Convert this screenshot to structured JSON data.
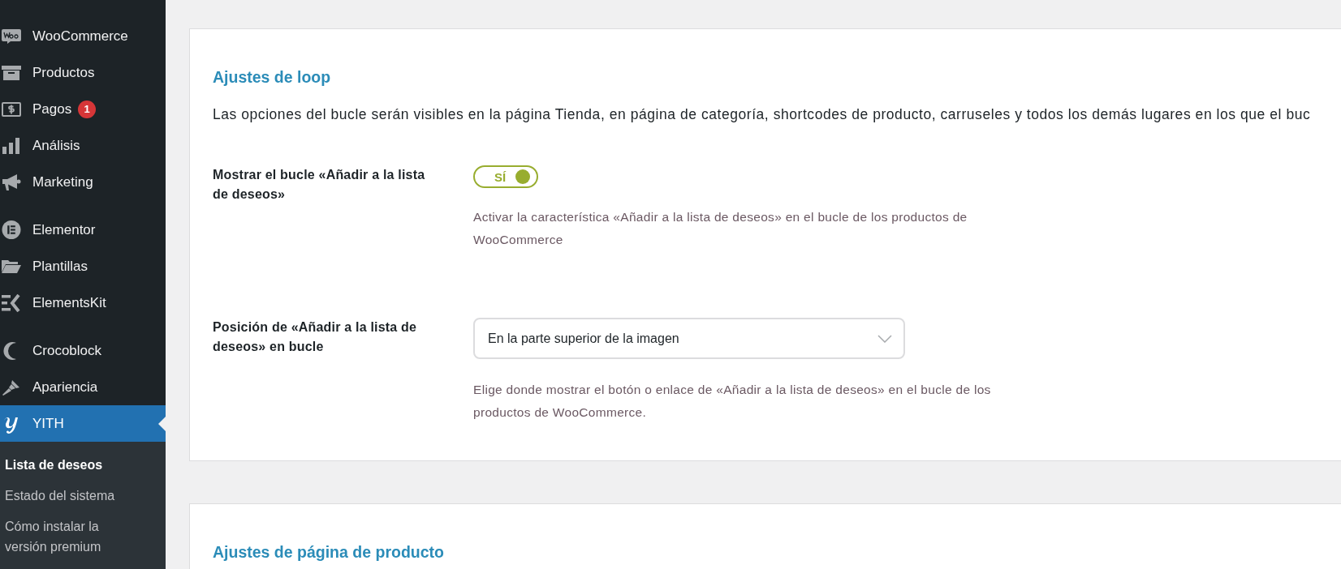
{
  "sidebar": {
    "groups": [
      {
        "items": [
          {
            "label": "WooCommerce",
            "selected": false
          },
          {
            "label": "Productos",
            "selected": false
          },
          {
            "label": "Pagos",
            "badge": "1",
            "selected": false
          },
          {
            "label": "Análisis",
            "selected": false
          },
          {
            "label": "Marketing",
            "selected": false
          }
        ]
      },
      {
        "items": [
          {
            "label": "Elementor",
            "selected": false
          },
          {
            "label": "Plantillas",
            "selected": false
          },
          {
            "label": "ElementsKit",
            "selected": false
          }
        ]
      },
      {
        "items": [
          {
            "label": "Crocoblock",
            "selected": false
          },
          {
            "label": "Apariencia",
            "selected": false
          },
          {
            "label": "YITH",
            "selected": true
          }
        ]
      }
    ],
    "submenu": [
      {
        "label": "Lista de deseos",
        "selected": true
      },
      {
        "label": "Estado del sistema",
        "selected": false
      },
      {
        "label": "Cómo instalar la versión premium",
        "selected": false
      }
    ]
  },
  "sections": [
    {
      "title": "Ajustes de loop",
      "description": "Las opciones del bucle serán visibles en la página Tienda, en página de categoría, shortcodes de producto, carruseles y todos los demás lugares en los que el buc",
      "options": [
        {
          "kind": "toggle",
          "label": "Mostrar el bucle «Añadir a la lista de deseos»",
          "toggle_label": "SÍ",
          "on": true,
          "help": "Activar la característica «Añadir a la lista de deseos» en el bucle de los productos de WooCommerce"
        },
        {
          "kind": "select",
          "label": "Posición de «Añadir a la lista de deseos» en bucle",
          "value": "En la parte superior de la imagen",
          "help": "Elige donde mostrar el botón o enlace de «Añadir a la lista de deseos» en el bucle de los productos de WooCommerce."
        }
      ]
    },
    {
      "title": "Ajustes de página de producto"
    }
  ]
}
